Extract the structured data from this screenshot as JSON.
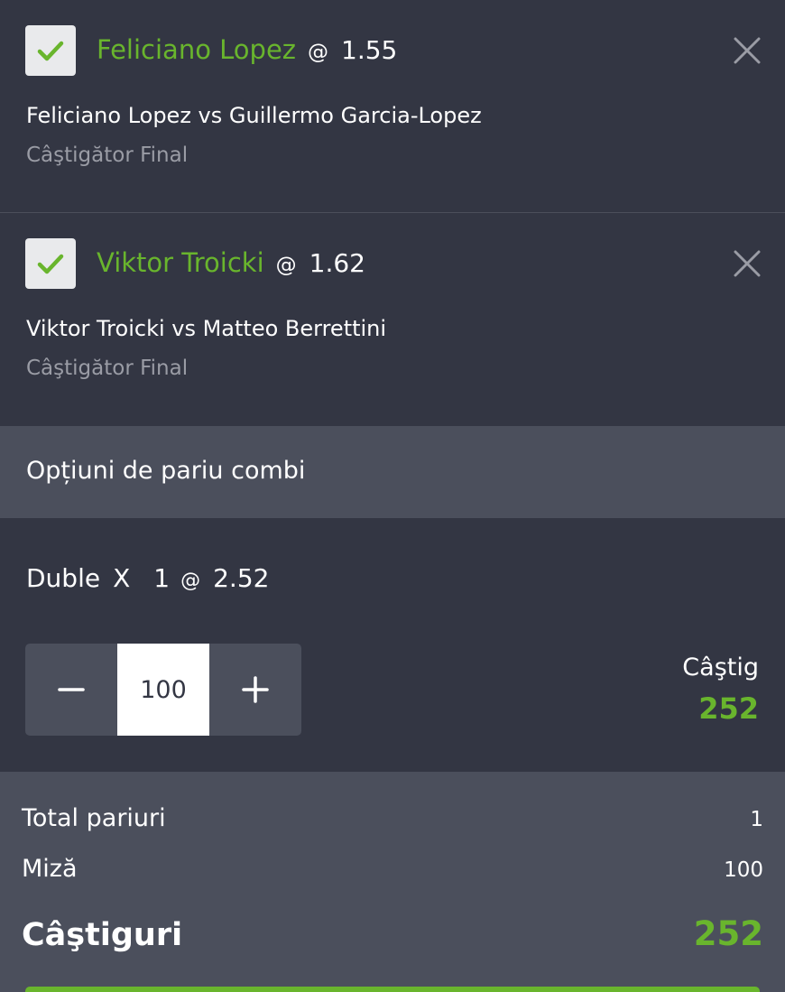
{
  "colors": {
    "accent_green": "#69b52d",
    "background": "#333643",
    "panel": "#4b4f5c",
    "muted_text": "#9a9ca5"
  },
  "selections": [
    {
      "player": "Feliciano Lopez",
      "at": "@",
      "odds": "1.55",
      "match": "Feliciano Lopez vs Guillermo Garcia-Lopez",
      "market": "Câştigător Final",
      "checked": true,
      "check_icon": "check-icon",
      "close_icon": "close-icon"
    },
    {
      "player": "Viktor Troicki",
      "at": "@",
      "odds": "1.62",
      "match": "Viktor Troicki vs Matteo Berrettini",
      "market": "Câştigător Final",
      "checked": true,
      "check_icon": "check-icon",
      "close_icon": "close-icon"
    }
  ],
  "combi": {
    "section_title": "Opțiuni de pariu combi",
    "type": "Duble",
    "x": "X",
    "count": "1",
    "at": "@",
    "odds": "2.52",
    "stake_value": "100",
    "minus_icon": "minus-icon",
    "plus_icon": "plus-icon",
    "win_label": "Câştig",
    "win_value": "252"
  },
  "summary": {
    "total_label": "Total pariuri",
    "total_value": "1",
    "stake_label": "Miză",
    "stake_value": "100",
    "winnings_label": "Câştiguri",
    "winnings_value": "252"
  }
}
